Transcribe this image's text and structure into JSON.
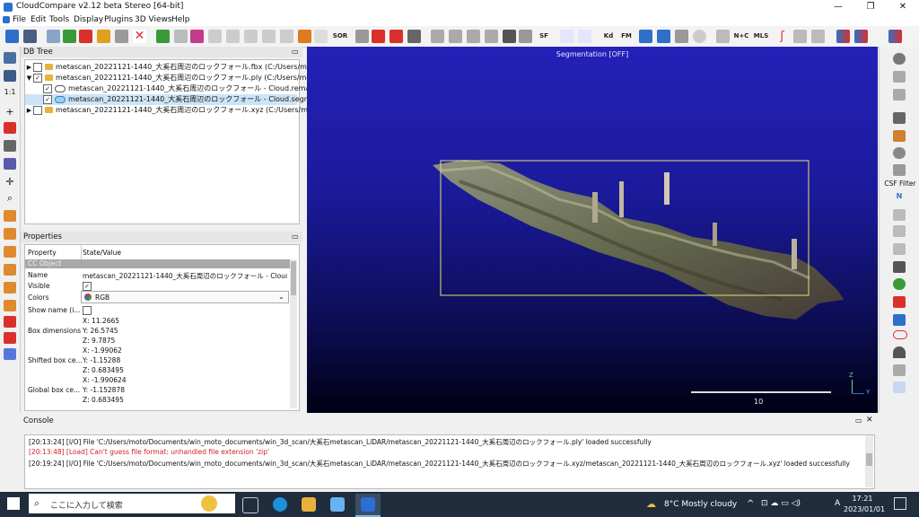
{
  "window": {
    "title": "CloudCompare v2.12 beta Stereo [64-bit]",
    "controls": [
      "—",
      "❐",
      "✕"
    ]
  },
  "menu": [
    "File",
    "Edit",
    "Tools",
    "Display",
    "Plugins",
    "3D Views",
    "Help"
  ],
  "toolbar": {
    "labels": [
      "SOR",
      "SF",
      "Kd",
      "FM",
      "N+C",
      "MLS"
    ],
    "colors": {
      "red": "#d9302c",
      "blue": "#2f6fc9",
      "green": "#3a9a3a",
      "gray": "#777777"
    }
  },
  "db_tree": {
    "title": "DB Tree",
    "items": [
      {
        "label": "metascan_20221121-1440_大奚石周辺のロックフォール.fbx (C:/Users/moto/...",
        "level": 0,
        "checked": false,
        "expanded": false
      },
      {
        "label": "metascan_20221121-1440_大奚石周辺のロックフォール.ply (C:/Users/moto/...",
        "level": 0,
        "checked": true,
        "expanded": true
      },
      {
        "label": "metascan_20221121-1440_大奚石周辺のロックフォール - Cloud.remaining",
        "level": 1,
        "checked": true,
        "selected": false
      },
      {
        "label": "metascan_20221121-1440_大奚石周辺のロックフォール - Cloud.segmented",
        "level": 1,
        "checked": true,
        "selected": true
      },
      {
        "label": "metascan_20221121-1440_大奚石周辺のロックフォール.xyz (C:/Users/moto/...",
        "level": 0,
        "checked": false,
        "expanded": false
      }
    ]
  },
  "properties": {
    "title": "Properties",
    "col_property": "Property",
    "col_value": "State/Value",
    "section": "CC Object",
    "name_label": "Name",
    "name_value": "metascan_20221121-1440_大奚石周辺のロックフォール - Cloud.seg...",
    "visible_label": "Visible",
    "colors_label": "Colors",
    "colors_value": "RGB",
    "showname_label": "Show name (i...",
    "box_dim_label": "Box dimensions",
    "box_dim": [
      "X: 11.2665",
      "Y: 26.5745",
      "Z: 9.7875"
    ],
    "shifted_label": "Shifted box ce...",
    "shifted": [
      "X: -1.99062",
      "Y: -1.15288",
      "Z: 0.683495"
    ],
    "global_label": "Global box ce...",
    "global": [
      "X: -1.990624",
      "Y: -1.152878",
      "Z: 0.683495"
    ]
  },
  "viewport": {
    "segmentation_label": "Segmentation [OFF]",
    "scale_label": "10",
    "axis_z": "Z",
    "axis_y": "Y"
  },
  "right_toolbar": {
    "csf_label": "CSF Filter",
    "n_label": "N"
  },
  "console": {
    "title": "Console",
    "lines": [
      {
        "text": "[20:13:24] [I/O] File 'C:/Users/moto/Documents/win_moto_documents/win_3d_scan/大奚石metascan_LiDAR/metascan_20221121-1440_大奚石周辺のロックフォール.ply' loaded successfully",
        "color": "#1a1a1a"
      },
      {
        "text": "[20:13:48] [Load] Can't guess file format: unhandled file extension 'zip'",
        "color": "#d22222"
      },
      {
        "text": "[20:19:24] [I/O] File 'C:/Users/moto/Documents/win_moto_documents/win_3d_scan/大奚石metascan_LiDAR/metascan_20221121-1440_大奚石周辺のロックフォール.xyz/metascan_20221121-1440_大奚石周辺のロックフォール.xyz' loaded successfully",
        "color": "#1a1a1a"
      }
    ]
  },
  "taskbar": {
    "search_placeholder": "ここに入力して検索",
    "weather": "8°C  Mostly cloudy",
    "time": "17:21",
    "date": "2023/01/01",
    "lang": "A"
  }
}
